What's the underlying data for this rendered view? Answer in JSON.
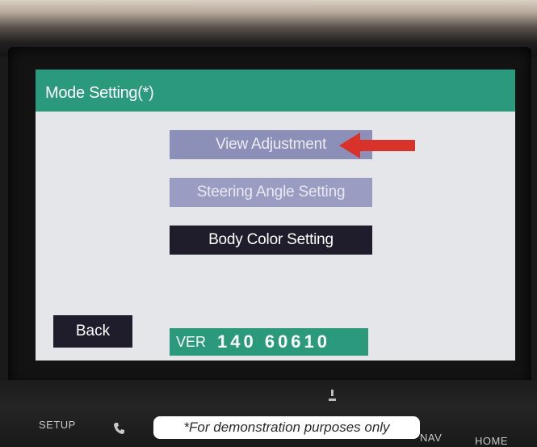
{
  "screen": {
    "title": "Mode Setting(*)",
    "menu": {
      "view_adjustment": "View Adjustment",
      "steering_angle": "Steering Angle Setting",
      "body_color": "Body Color Setting"
    },
    "back_label": "Back",
    "version": {
      "label": "VER",
      "number": "140 60610"
    }
  },
  "hardware_buttons": {
    "setup": "SETUP",
    "nav": "NAV",
    "home": "HOME"
  },
  "caption": "*For demonstration purposes only",
  "colors": {
    "title_bar": "#2b9a7c",
    "arrow": "#d8322a",
    "button_light": "#8c8fb7",
    "button_dark": "#1f1c2b"
  },
  "icons": {
    "phone": "phone-icon",
    "arrow": "red-arrow-icon"
  }
}
